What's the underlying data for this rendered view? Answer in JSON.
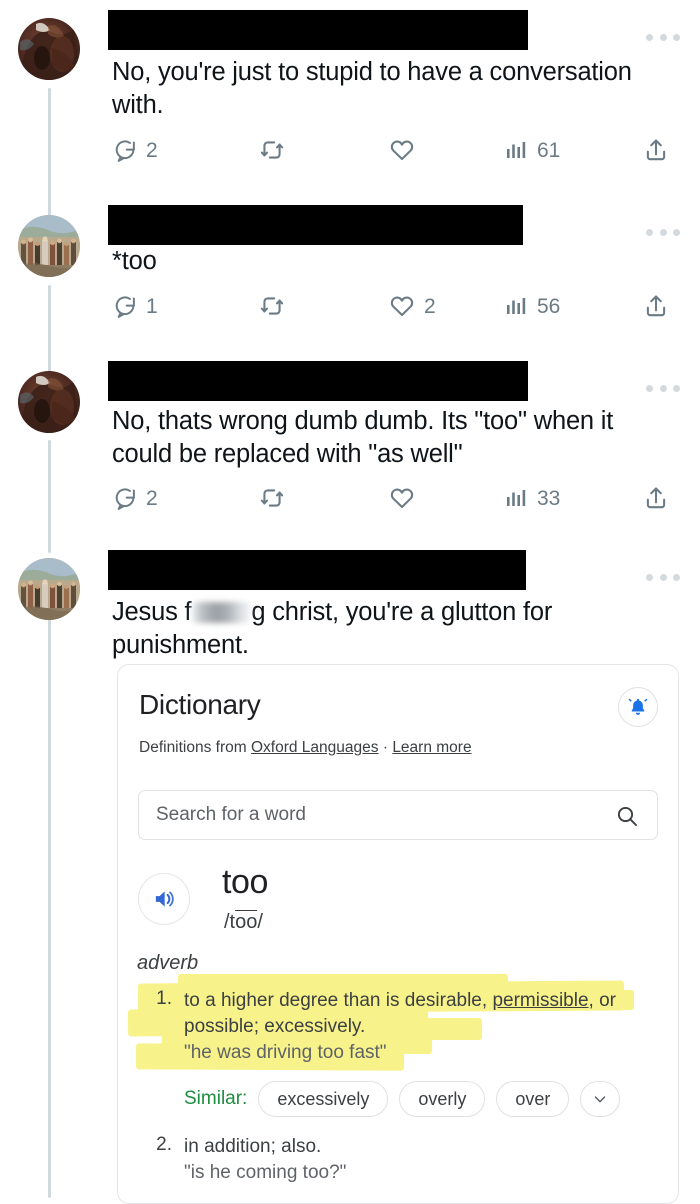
{
  "thread": {
    "tweets": [
      {
        "id": "tweet-1",
        "author_redacted": true,
        "avatar": "dark-painting-avatar",
        "text": "No, you're just to stupid to have a conversation with.",
        "actions": {
          "reply_icon": "reply-icon",
          "reply_count": "2",
          "retweet_icon": "retweet-icon",
          "retweet_count": "",
          "like_icon": "heart-icon",
          "like_count": "",
          "views_icon": "views-bar-chart-icon",
          "views_count": "61",
          "share_icon": "share-icon"
        },
        "more_icon": "more-options-icon"
      },
      {
        "id": "tweet-2",
        "author_redacted": true,
        "avatar": "crowd-painting-avatar",
        "text": "*too",
        "actions": {
          "reply_icon": "reply-icon",
          "reply_count": "1",
          "retweet_icon": "retweet-icon",
          "retweet_count": "",
          "like_icon": "heart-icon",
          "like_count": "2",
          "views_icon": "views-bar-chart-icon",
          "views_count": "56",
          "share_icon": "share-icon"
        },
        "more_icon": "more-options-icon"
      },
      {
        "id": "tweet-3",
        "author_redacted": true,
        "avatar": "dark-painting-avatar",
        "text": "No, thats wrong dumb dumb. Its \"too\" when it could be replaced with \"as well\"",
        "actions": {
          "reply_icon": "reply-icon",
          "reply_count": "2",
          "retweet_icon": "retweet-icon",
          "retweet_count": "",
          "like_icon": "heart-icon",
          "like_count": "",
          "views_icon": "views-bar-chart-icon",
          "views_count": "33",
          "share_icon": "share-icon"
        },
        "more_icon": "more-options-icon"
      },
      {
        "id": "tweet-4",
        "author_redacted": true,
        "avatar": "crowd-painting-avatar",
        "text_before_blur": "Jesus f",
        "text_after_blur": "g christ, you're a glutton for punishment.",
        "blur_censored": true,
        "more_icon": "more-options-icon"
      }
    ]
  },
  "dictionary_card": {
    "title": "Dictionary",
    "bell_icon": "notification-bell-icon",
    "attribution_prefix": "Definitions from ",
    "attribution_source": "Oxford Languages",
    "attribution_separator": " · ",
    "attribution_learn_more": "Learn more",
    "search": {
      "placeholder": "Search for a word",
      "icon": "search-icon"
    },
    "entry": {
      "speaker_icon": "speaker-audio-icon",
      "headword": "too",
      "phonetic_prefix": "/t",
      "phonetic_oo": "oo",
      "phonetic_suffix": "/",
      "part_of_speech": "adverb",
      "definitions": [
        {
          "number": "1.",
          "text_a": "to a higher degree than is desirable, ",
          "text_link": "permissible",
          "text_b": ", or possible; excessively.",
          "example": "\"he was driving too fast\"",
          "highlighted": true
        },
        {
          "number": "2.",
          "text_a": "in addition; also.",
          "text_link": "",
          "text_b": "",
          "example": "\"is he coming too?\"",
          "highlighted": false
        }
      ],
      "similar": {
        "label": "Similar:",
        "chips": [
          "excessively",
          "overly",
          "over"
        ],
        "expand_icon": "chevron-down-icon"
      }
    },
    "highlight_color": "#f7f38a",
    "accent_green": "#1e8e3e",
    "accent_blue": "#1a73e8"
  }
}
